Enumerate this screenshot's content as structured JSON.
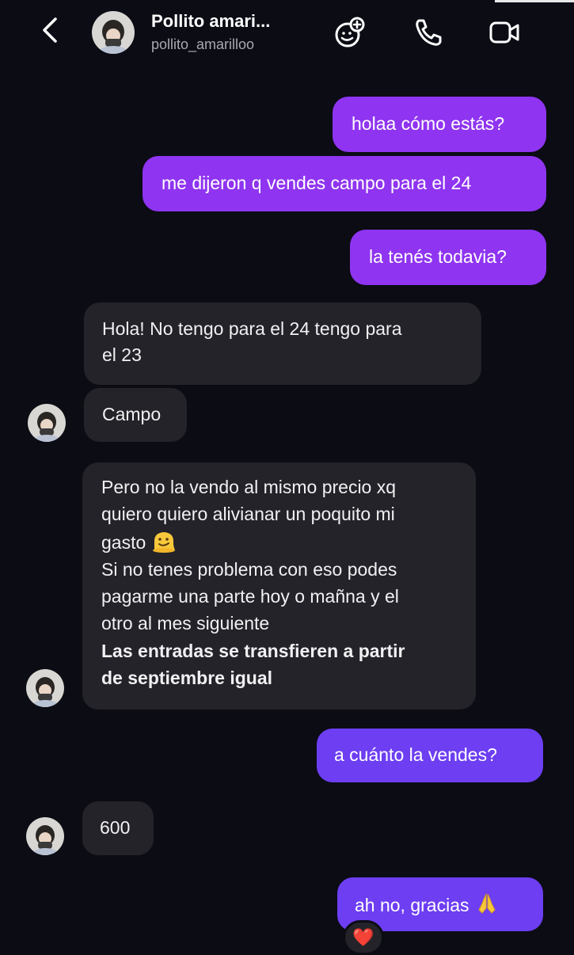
{
  "header": {
    "title": "Pollito amari...",
    "username": "pollito_amarilloo"
  },
  "messages": [
    {
      "from": "me",
      "text": "holaa cómo estás?"
    },
    {
      "from": "me",
      "text": "me dijeron q vendes campo para el 24"
    },
    {
      "from": "me",
      "text": "la tenés todavia?"
    },
    {
      "from": "them",
      "lines": [
        "Hola! No tengo para el 24 tengo para",
        "el 23"
      ]
    },
    {
      "from": "them",
      "text": "Campo"
    },
    {
      "from": "them",
      "lines": [
        "Pero no la vendo al mismo precio xq",
        "quiero quiero alivianar un poquito mi",
        "gasto",
        "Si no tenes problema con eso podes",
        "pagarme una parte hoy o mañna y el",
        "otro al mes siguiente",
        "Las entradas se transfieren a partir",
        "de septiembre igual"
      ]
    },
    {
      "from": "me",
      "text": "a cuánto la vendes?"
    },
    {
      "from": "them",
      "text": "600"
    },
    {
      "from": "me",
      "text": "ah no, gracias",
      "reaction": "❤️"
    }
  ],
  "icons": {
    "gasto_emoji": "melting-face-emoji",
    "gracias_emoji": "folded-hands-emoji"
  },
  "colors": {
    "background": "#0b0c14",
    "sent_bubble": "#8f34f0",
    "sent_bubble_later": "#6d3ef2",
    "received_bubble": "#232329"
  }
}
